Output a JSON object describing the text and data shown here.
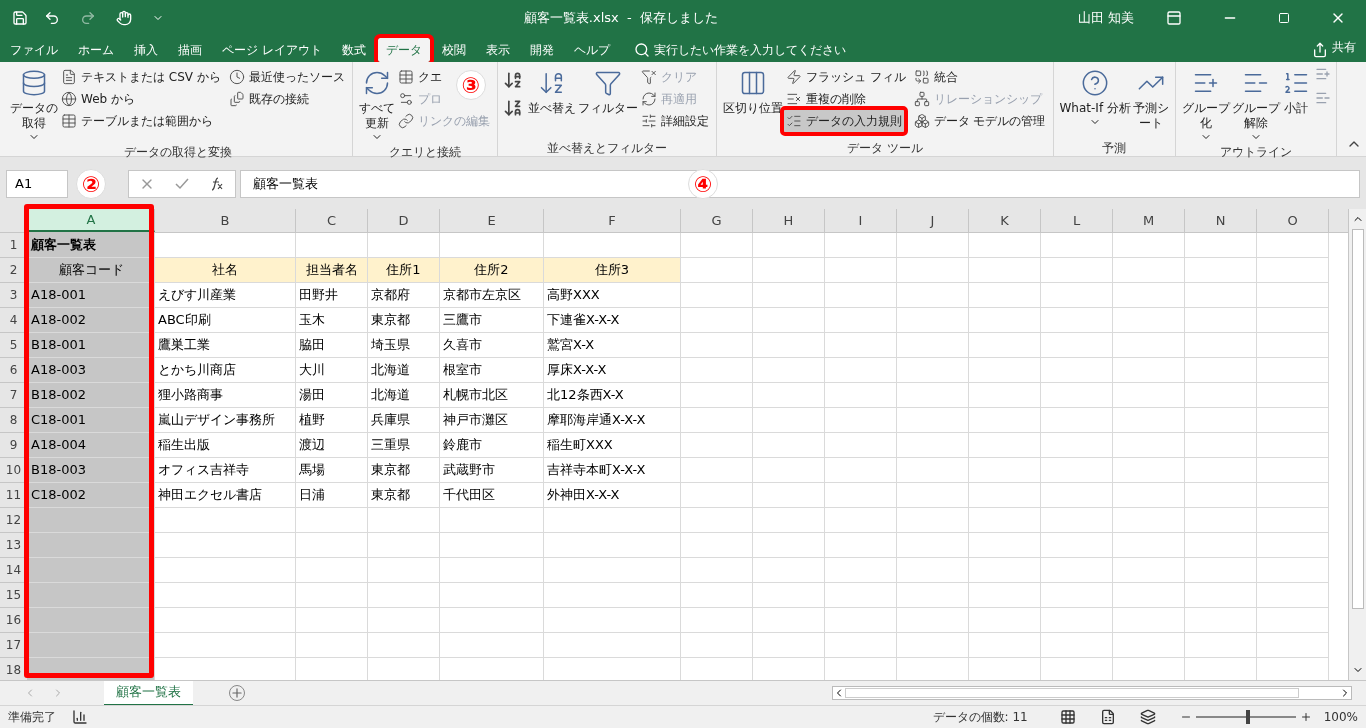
{
  "title_bar": {
    "title": "顧客一覧表.xlsx  -  保存しました",
    "user": "山田 知美"
  },
  "menu_tabs": [
    {
      "label": "ファイル",
      "selected": false,
      "framed": false
    },
    {
      "label": "ホーム",
      "selected": false,
      "framed": false
    },
    {
      "label": "挿入",
      "selected": false,
      "framed": false
    },
    {
      "label": "描画",
      "selected": false,
      "framed": false
    },
    {
      "label": "ページ レイアウト",
      "selected": false,
      "framed": false
    },
    {
      "label": "数式",
      "selected": false,
      "framed": false
    },
    {
      "label": "データ",
      "selected": true,
      "framed": true
    },
    {
      "label": "校閲",
      "selected": false,
      "framed": false
    },
    {
      "label": "表示",
      "selected": false,
      "framed": false
    },
    {
      "label": "開発",
      "selected": false,
      "framed": false
    },
    {
      "label": "ヘルプ",
      "selected": false,
      "framed": false
    }
  ],
  "tell_me": "実行したい作業を入力してください",
  "share": "共有",
  "ribbon_groups": [
    {
      "name": "データの取得と変換",
      "large": [
        {
          "label": "データの取得",
          "caret": true
        }
      ],
      "small": [
        {
          "label": "テキストまたは CSV から",
          "disabled": false,
          "highlighted": false
        },
        {
          "label": "Web から",
          "disabled": false,
          "highlighted": false
        },
        {
          "label": "テーブルまたは範囲から",
          "disabled": false,
          "highlighted": false
        },
        {
          "label": "最近使ったソース",
          "disabled": false,
          "highlighted": false
        },
        {
          "label": "既存の接続",
          "disabled": false,
          "highlighted": false
        }
      ]
    },
    {
      "name": "クエリと接続",
      "large": [
        {
          "label": "すべて更新",
          "caret": true
        }
      ],
      "small": [
        {
          "label": "クエ",
          "disabled": false,
          "highlighted": false
        },
        {
          "label": "プロ",
          "disabled": true,
          "highlighted": false
        },
        {
          "label": "リンクの編集",
          "disabled": true,
          "highlighted": false
        }
      ]
    },
    {
      "name": "並べ替えとフィルター",
      "large": [
        {
          "label": "並べ替え",
          "caret": false
        },
        {
          "label": "フィルター",
          "caret": false
        }
      ],
      "small": [
        {
          "label": "クリア",
          "disabled": true,
          "highlighted": false
        },
        {
          "label": "再適用",
          "disabled": true,
          "highlighted": false
        },
        {
          "label": "詳細設定",
          "disabled": false,
          "highlighted": false
        }
      ]
    },
    {
      "name": "データ ツール",
      "large": [
        {
          "label": "区切り位置",
          "caret": false
        }
      ],
      "small": [
        {
          "label": "フラッシュ フィル",
          "disabled": false,
          "highlighted": false
        },
        {
          "label": "重複の削除",
          "disabled": false,
          "highlighted": false
        },
        {
          "label": "データの入力規則",
          "disabled": false,
          "highlighted": true
        },
        {
          "label": "統合",
          "disabled": false,
          "highlighted": false
        },
        {
          "label": "リレーションシップ",
          "disabled": true,
          "highlighted": false
        },
        {
          "label": "データ モデルの管理",
          "disabled": false,
          "highlighted": false
        }
      ]
    },
    {
      "name": "予測",
      "large": [
        {
          "label": "What-If 分析",
          "caret": true
        },
        {
          "label": "予測シート",
          "caret": false
        }
      ]
    },
    {
      "name": "アウトライン",
      "large": [
        {
          "label": "グループ化",
          "caret": true
        },
        {
          "label": "グループ解除",
          "caret": true
        },
        {
          "label": "小計",
          "caret": false
        }
      ]
    }
  ],
  "formula_bar": {
    "name_box": "A1",
    "value": "顧客一覧表"
  },
  "columns": [
    {
      "label": "A",
      "selected": true
    },
    {
      "label": "B",
      "selected": false
    },
    {
      "label": "C",
      "selected": false
    },
    {
      "label": "D",
      "selected": false
    },
    {
      "label": "E",
      "selected": false
    },
    {
      "label": "F",
      "selected": false
    },
    {
      "label": "G",
      "selected": false
    },
    {
      "label": "H",
      "selected": false
    },
    {
      "label": "I",
      "selected": false
    },
    {
      "label": "J",
      "selected": false
    },
    {
      "label": "K",
      "selected": false
    },
    {
      "label": "L",
      "selected": false
    },
    {
      "label": "M",
      "selected": false
    },
    {
      "label": "N",
      "selected": false
    },
    {
      "label": "O",
      "selected": false
    }
  ],
  "rows": [
    {
      "number": "1",
      "kind": "title",
      "cells": [
        "顧客一覧表"
      ]
    },
    {
      "number": "2",
      "kind": "header",
      "cells": [
        "顧客コード",
        "社名",
        "担当者名",
        "住所1",
        "住所2",
        "住所3"
      ]
    },
    {
      "number": "3",
      "kind": "data",
      "cells": [
        "A18-001",
        "えびす川産業",
        "田野井",
        "京都府",
        "京都市左京区",
        "高野XXX"
      ]
    },
    {
      "number": "4",
      "kind": "data",
      "cells": [
        "A18-002",
        "ABC印刷",
        "玉木",
        "東京都",
        "三鷹市",
        "下連雀X-X-X"
      ]
    },
    {
      "number": "5",
      "kind": "data",
      "cells": [
        "B18-001",
        "鷹巣工業",
        "脇田",
        "埼玉県",
        "久喜市",
        "鷲宮X-X"
      ]
    },
    {
      "number": "6",
      "kind": "data",
      "cells": [
        "A18-003",
        "とかち川商店",
        "大川",
        "北海道",
        "根室市",
        "厚床X-X-X"
      ]
    },
    {
      "number": "7",
      "kind": "data",
      "cells": [
        "B18-002",
        "狸小路商事",
        "湯田",
        "北海道",
        "札幌市北区",
        "北12条西X-X"
      ]
    },
    {
      "number": "8",
      "kind": "data",
      "cells": [
        "C18-001",
        "嵐山デザイン事務所",
        "植野",
        "兵庫県",
        "神戸市灘区",
        "摩耶海岸通X-X-X"
      ]
    },
    {
      "number": "9",
      "kind": "data",
      "cells": [
        "A18-004",
        "稲生出版",
        "渡辺",
        "三重県",
        "鈴鹿市",
        "稲生町XXX"
      ]
    },
    {
      "number": "10",
      "kind": "data",
      "cells": [
        "B18-003",
        "オフィス吉祥寺",
        "馬場",
        "東京都",
        "武蔵野市",
        "吉祥寺本町X-X-X"
      ]
    },
    {
      "number": "11",
      "kind": "data",
      "cells": [
        "C18-002",
        "神田エクセル書店",
        "日浦",
        "東京都",
        "千代田区",
        "外神田X-X-X"
      ]
    },
    {
      "number": "12",
      "kind": "data",
      "cells": []
    },
    {
      "number": "13",
      "kind": "data",
      "cells": []
    },
    {
      "number": "14",
      "kind": "data",
      "cells": []
    },
    {
      "number": "15",
      "kind": "data",
      "cells": []
    },
    {
      "number": "16",
      "kind": "data",
      "cells": []
    },
    {
      "number": "17",
      "kind": "data",
      "cells": []
    },
    {
      "number": "18",
      "kind": "data",
      "cells": []
    }
  ],
  "sheet_tabs": [
    {
      "label": "顧客一覧表",
      "selected": true
    }
  ],
  "status_bar": {
    "ready": "準備完了",
    "count": "データの個数: 11",
    "zoom": "100%",
    "zoom_slider": {
      "level": 0.5
    }
  },
  "annotations": [
    {
      "label": "②"
    },
    {
      "label": "③"
    },
    {
      "label": "④"
    }
  ]
}
